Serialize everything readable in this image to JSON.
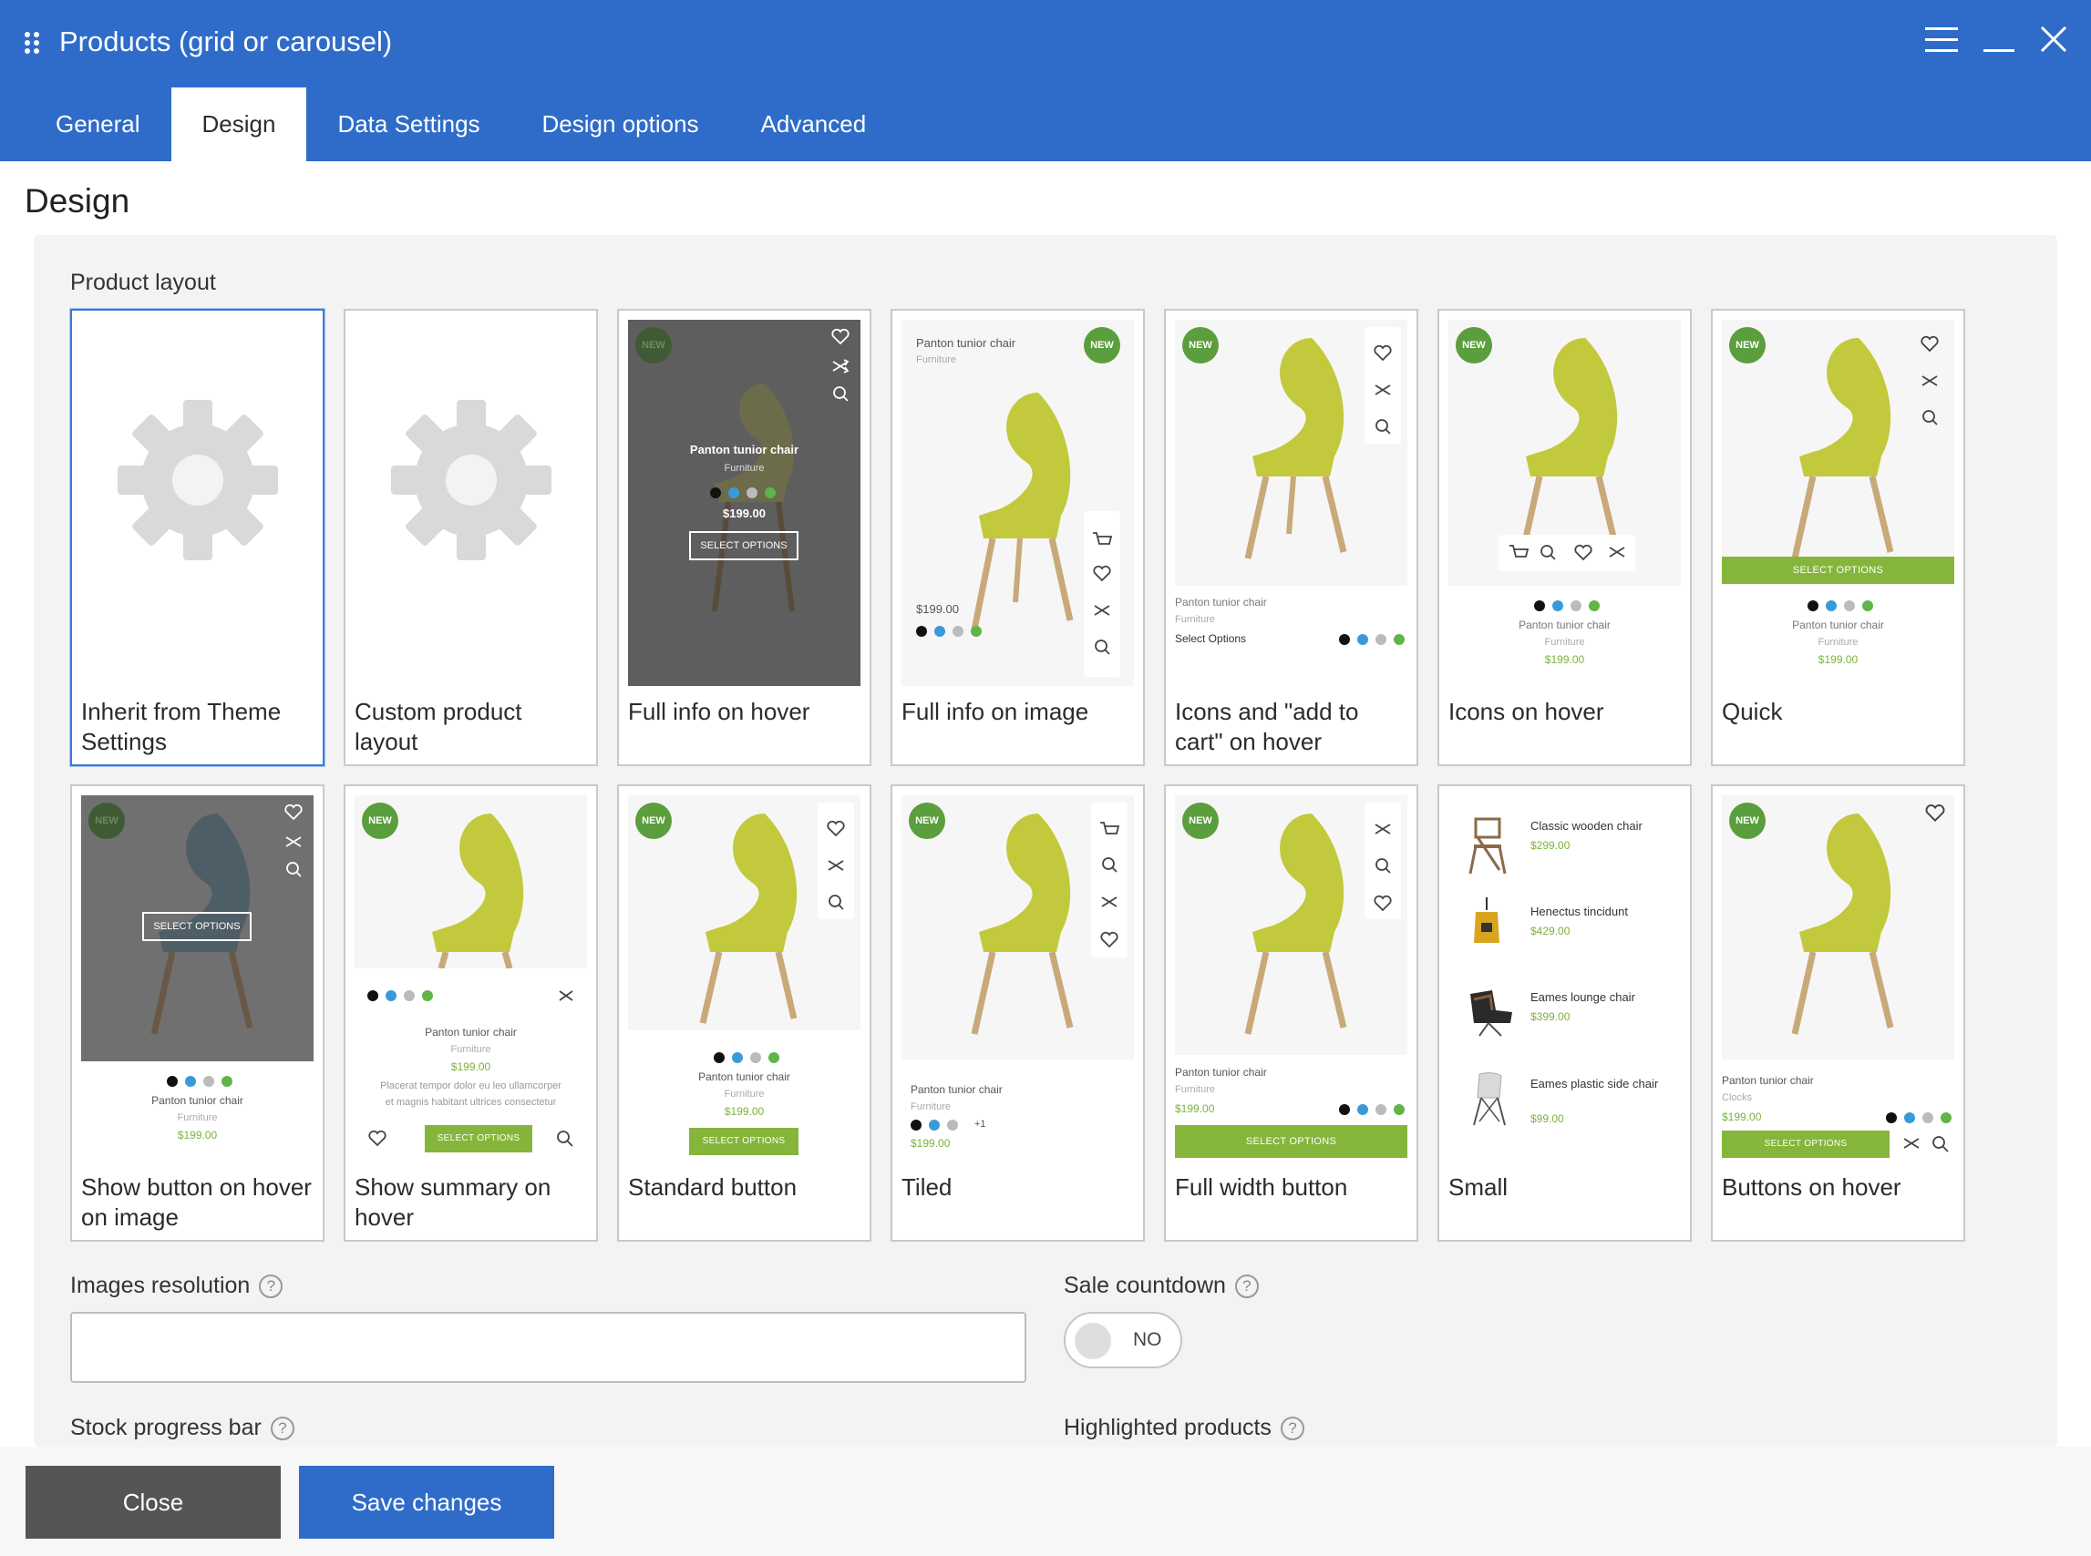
{
  "window": {
    "title": "Products (grid or carousel)"
  },
  "tabs": [
    {
      "label": "General",
      "active": false
    },
    {
      "label": "Design",
      "active": true
    },
    {
      "label": "Data Settings",
      "active": false
    },
    {
      "label": "Design options",
      "active": false
    },
    {
      "label": "Advanced",
      "active": false
    }
  ],
  "section_title": "Design",
  "product_layout": {
    "label": "Product layout",
    "selected": "Inherit from Theme Settings",
    "options": [
      {
        "label": "Inherit from Theme Settings"
      },
      {
        "label": "Custom product layout"
      },
      {
        "label": "Full info on hover"
      },
      {
        "label": "Full info on image"
      },
      {
        "label": "Icons and \"add to cart\" on hover"
      },
      {
        "label": "Icons on hover"
      },
      {
        "label": "Quick"
      },
      {
        "label": "Show button on hover on image"
      },
      {
        "label": "Show summary on hover"
      },
      {
        "label": "Standard button"
      },
      {
        "label": "Tiled"
      },
      {
        "label": "Full width button"
      },
      {
        "label": "Small"
      },
      {
        "label": "Buttons on hover"
      }
    ]
  },
  "preview": {
    "product_name": "Panton tunior chair",
    "category": "Furniture",
    "category_alt": "Clocks",
    "price": "$199.00",
    "badge": "NEW",
    "select_options": "SELECT OPTIONS",
    "select_options_text": "Select Options",
    "summary_text_1": "Placerat tempor dolor eu leo ullamcorper",
    "summary_text_2": "et magnis habitant ultrices consectetur",
    "more_colors": "+1",
    "swatch_colors": [
      "#111111",
      "#3a9ad9",
      "#bbbbbb",
      "#5fb548"
    ],
    "small_list": [
      {
        "name": "Classic wooden chair",
        "price": "$299.00"
      },
      {
        "name": "Henectus tincidunt",
        "price": "$429.00"
      },
      {
        "name": "Eames lounge chair",
        "price": "$399.00"
      },
      {
        "name": "Eames plastic side chair",
        "price": "$99.00"
      }
    ]
  },
  "images_resolution": {
    "label": "Images resolution",
    "value": "",
    "help": "?"
  },
  "sale_countdown": {
    "label": "Sale countdown",
    "state": "NO",
    "help": "?"
  },
  "stock_progress_bar": {
    "label": "Stock progress bar",
    "help": "?"
  },
  "highlighted_products": {
    "label": "Highlighted products",
    "help": "?"
  },
  "footer": {
    "close_label": "Close",
    "save_label": "Save changes"
  },
  "colors": {
    "header": "#2f6cc9",
    "accent_green": "#86b53c",
    "badge_green": "#5b9e3d"
  }
}
